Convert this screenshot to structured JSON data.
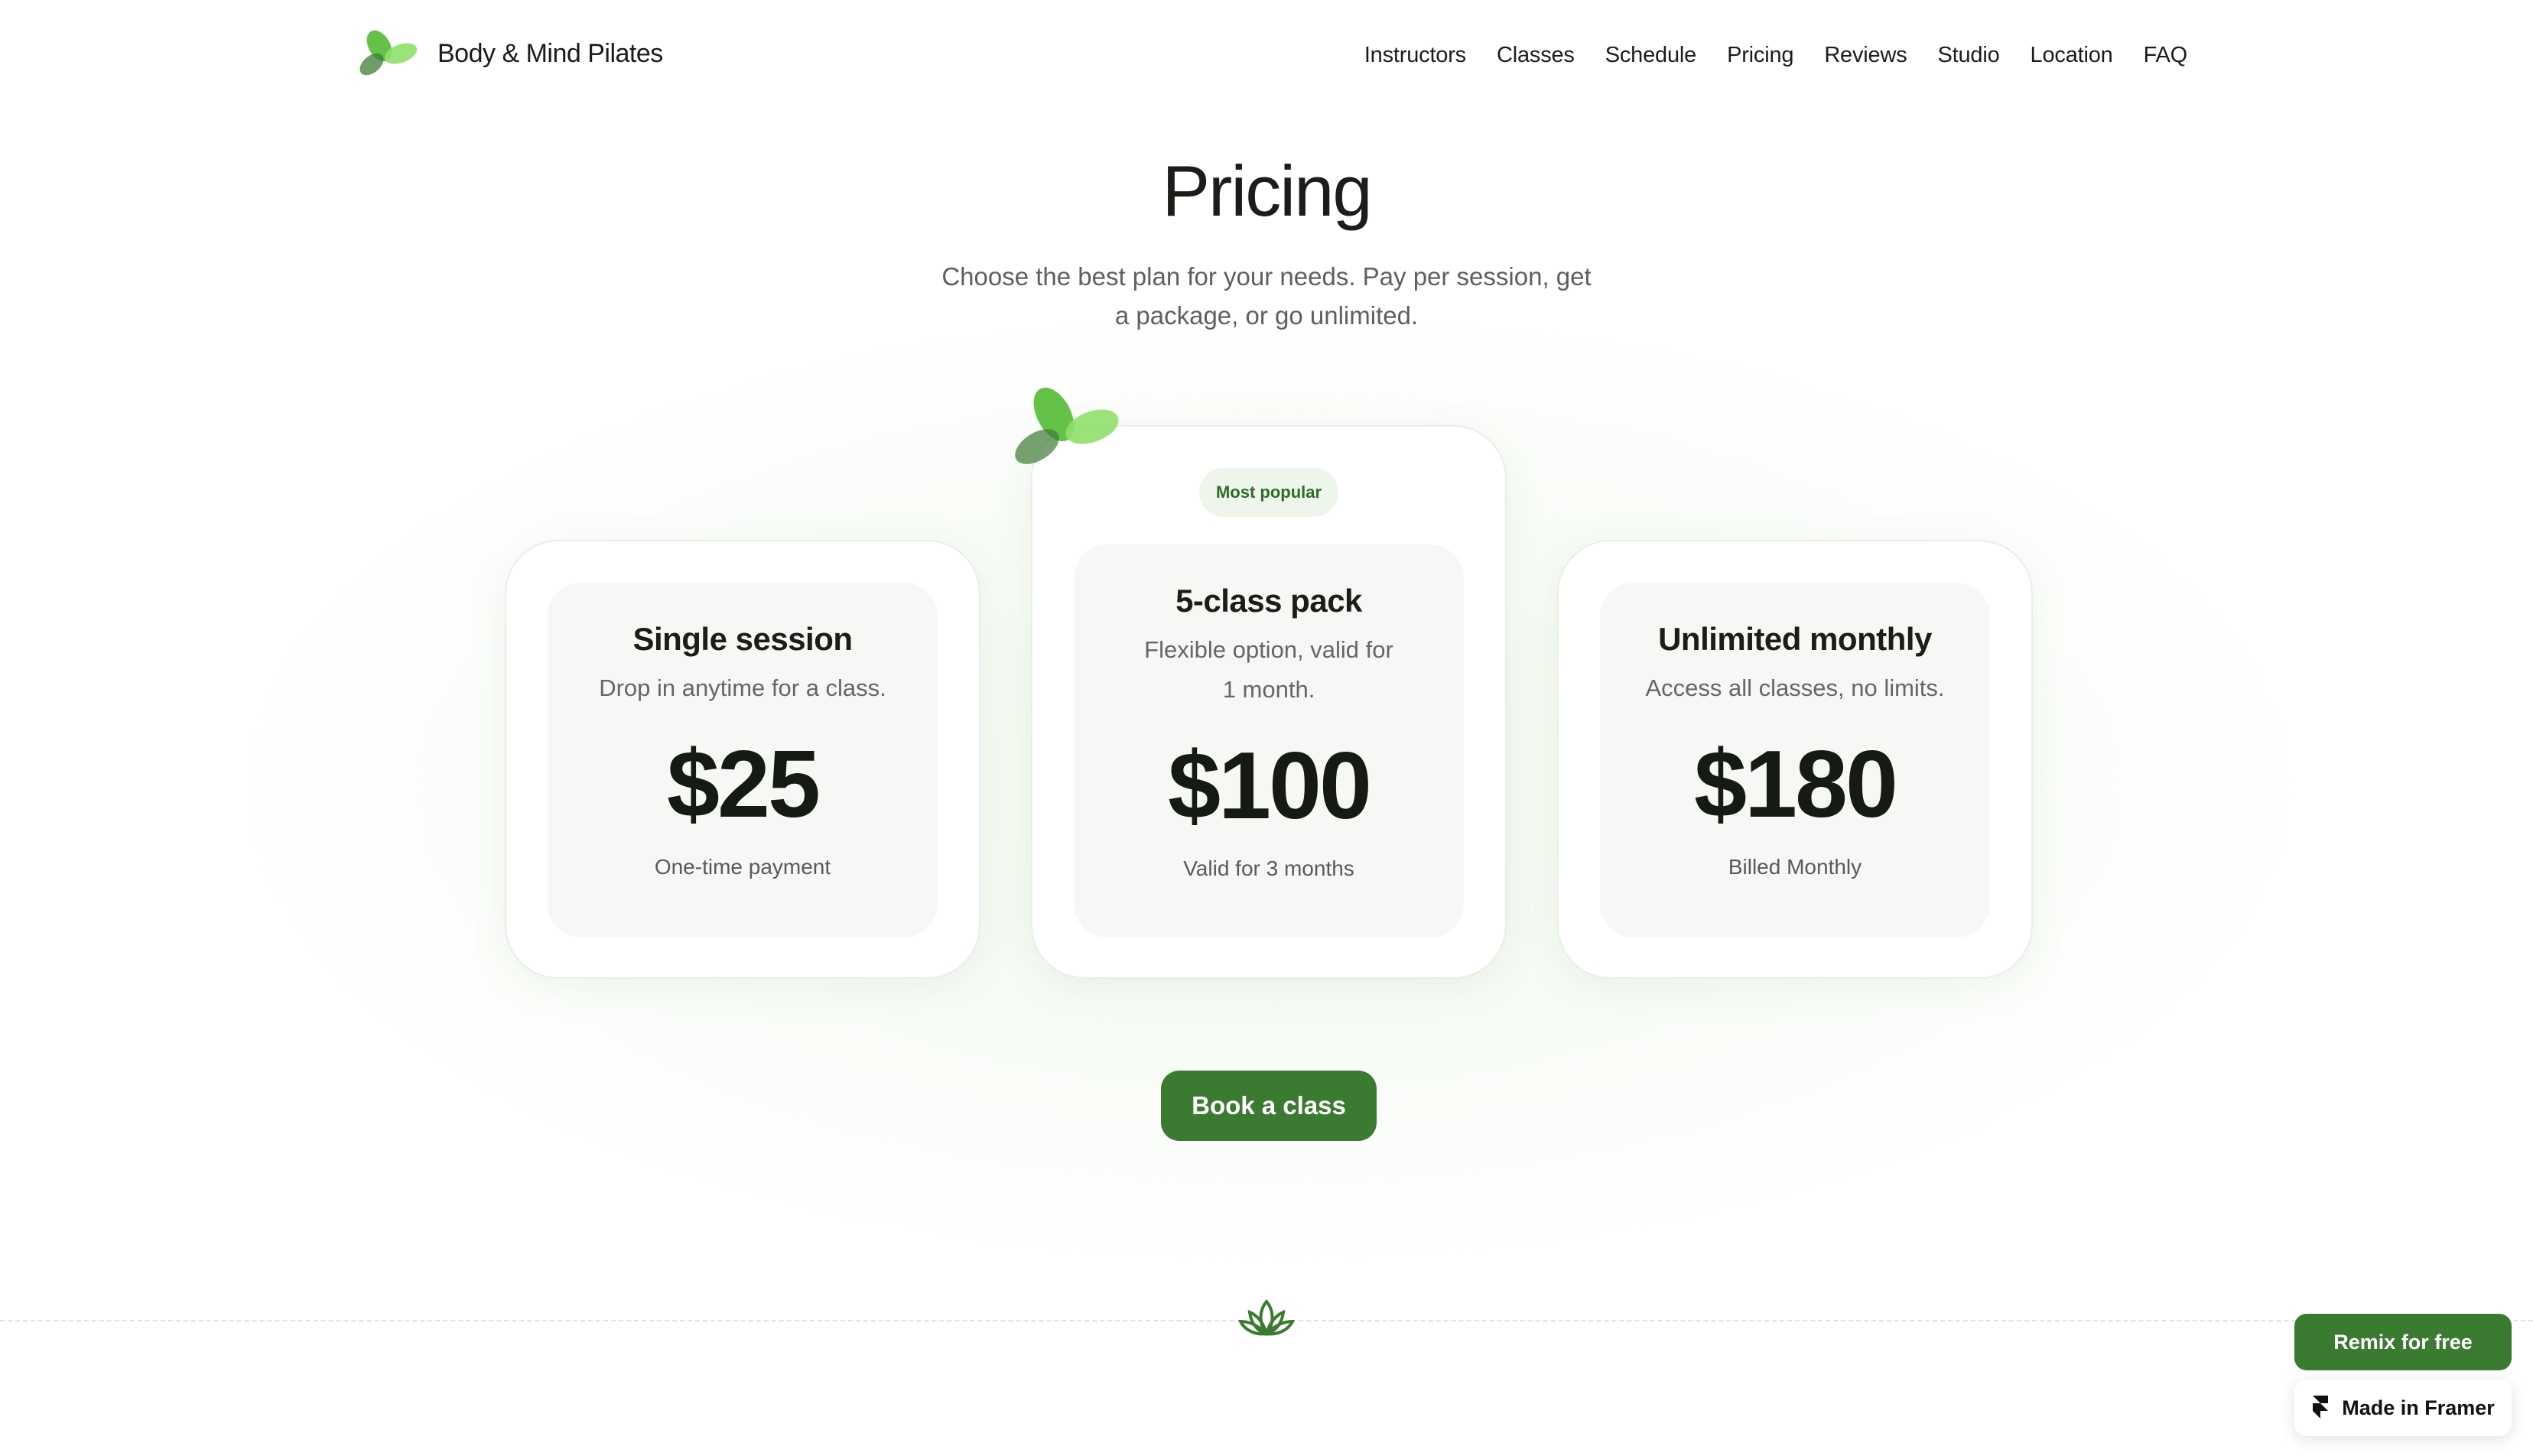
{
  "header": {
    "brand": "Body & Mind Pilates",
    "logo_icon": "leaf-logo-icon",
    "nav": [
      "Instructors",
      "Classes",
      "Schedule",
      "Pricing",
      "Reviews",
      "Studio",
      "Location",
      "FAQ"
    ]
  },
  "hero": {
    "title": "Pricing",
    "subtitle": "Choose the best plan for your needs. Pay per session, get a package, or go unlimited."
  },
  "plans": [
    {
      "name": "Single session",
      "description": "Drop in anytime for a class.",
      "price": "$25",
      "note": "One-time payment"
    },
    {
      "name": "5-class pack",
      "description": "Flexible option, valid for 1 month.",
      "price": "$100",
      "note": "Valid for 3 months",
      "badge": "Most popular"
    },
    {
      "name": "Unlimited monthly",
      "description": "Access all classes, no limits.",
      "price": "$180",
      "note": "Billed Monthly"
    }
  ],
  "cta": {
    "label": "Book a class"
  },
  "footer": {
    "divider_icon": "lotus-icon"
  },
  "floating": {
    "remix_label": "Remix for free",
    "framer_label": "Made in Framer",
    "framer_icon": "framer-icon"
  },
  "colors": {
    "accent": "#3b7a31",
    "leaf_light": "#8fe06a",
    "leaf_mid": "#5cbf3f",
    "leaf_dark": "#3f7b34",
    "badge_bg": "#eef5ea",
    "card_inner": "#f7f7f6"
  }
}
